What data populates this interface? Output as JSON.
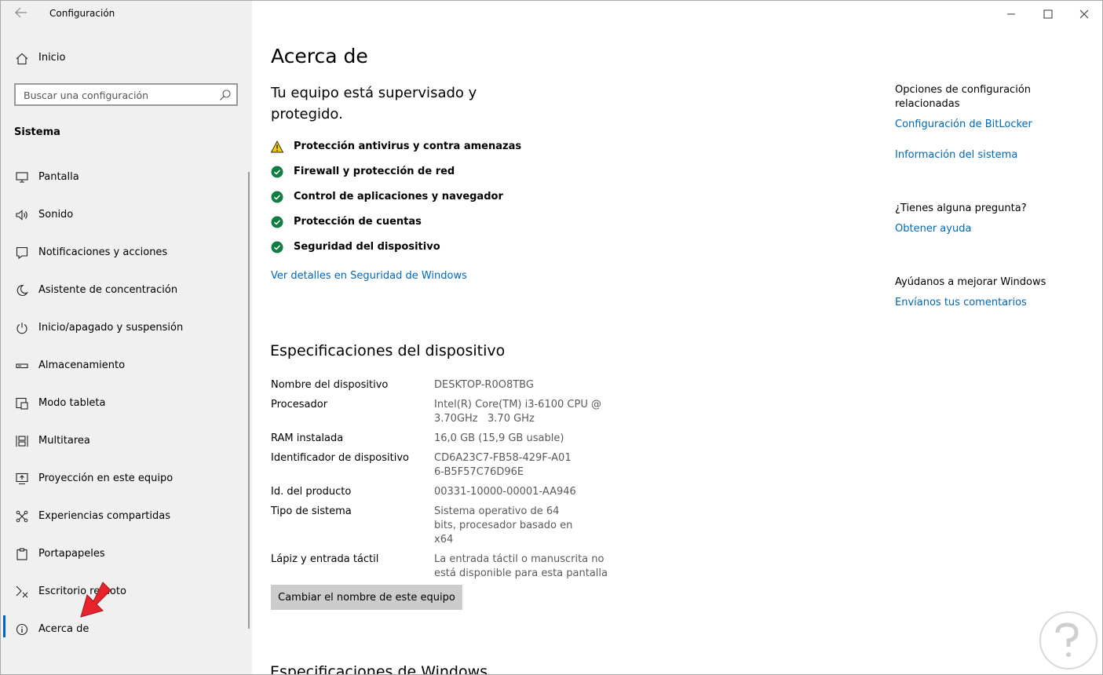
{
  "window": {
    "title": "Configuración",
    "controls": {
      "minimize": "minimize-icon",
      "maximize": "maximize-icon",
      "close": "close-icon"
    }
  },
  "sidebar": {
    "home_label": "Inicio",
    "search_placeholder": "Buscar una configuración",
    "section_title": "Sistema",
    "items": [
      {
        "label": "Pantalla",
        "icon": "display-icon"
      },
      {
        "label": "Sonido",
        "icon": "speaker-icon"
      },
      {
        "label": "Notificaciones y acciones",
        "icon": "notification-icon"
      },
      {
        "label": "Asistente de concentración",
        "icon": "moon-icon"
      },
      {
        "label": "Inicio/apagado y suspensión",
        "icon": "power-icon"
      },
      {
        "label": "Almacenamiento",
        "icon": "storage-icon"
      },
      {
        "label": "Modo tableta",
        "icon": "tablet-icon"
      },
      {
        "label": "Multitarea",
        "icon": "multitask-icon"
      },
      {
        "label": "Proyección en este equipo",
        "icon": "projection-icon"
      },
      {
        "label": "Experiencias compartidas",
        "icon": "shared-icon"
      },
      {
        "label": "Portapapeles",
        "icon": "clipboard-icon"
      },
      {
        "label": "Escritorio remoto",
        "icon": "remote-desktop-icon"
      },
      {
        "label": "Acerca de",
        "icon": "info-icon",
        "active": true
      }
    ]
  },
  "main": {
    "title": "Acerca de",
    "protection_heading": "Tu equipo está supervisado y protegido.",
    "status_items": [
      {
        "label": "Protección antivirus y contra amenazas",
        "status": "warning"
      },
      {
        "label": "Firewall y protección de red",
        "status": "ok"
      },
      {
        "label": "Control de aplicaciones y navegador",
        "status": "ok"
      },
      {
        "label": "Protección de cuentas",
        "status": "ok"
      },
      {
        "label": "Seguridad del dispositivo",
        "status": "ok"
      }
    ],
    "security_link": "Ver detalles en Seguridad de Windows",
    "specs_title": "Especificaciones del dispositivo",
    "specs": [
      {
        "key": "Nombre del dispositivo",
        "value": "DESKTOP-R0O8TBG"
      },
      {
        "key": "Procesador",
        "value": "Intel(R) Core(TM) i3-6100 CPU @ 3.70GHz   3.70 GHz"
      },
      {
        "key": "RAM instalada",
        "value": "16,0 GB (15,9 GB usable)"
      },
      {
        "key": "Identificador de dispositivo",
        "value": "CD6A23C7-FB58-429F-A016-B5F57C76D96E"
      },
      {
        "key": "Id. del producto",
        "value": "00331-10000-00001-AA946"
      },
      {
        "key": "Tipo de sistema",
        "value": "Sistema operativo de 64 bits, procesador basado en x64"
      },
      {
        "key": "Lápiz y entrada táctil",
        "value": "La entrada táctil o manuscrita no está disponible para esta pantalla"
      }
    ],
    "rename_button": "Cambiar el nombre de este equipo",
    "windows_specs_title": "Especificaciones de Windows"
  },
  "related": {
    "heading": "Opciones de configuración relacionadas",
    "bitlocker_link": "Configuración de BitLocker",
    "sysinfo_link": "Información del sistema",
    "question_heading": "¿Tienes alguna pregunta?",
    "help_link": "Obtener ayuda",
    "improve_heading": "Ayúdanos a mejorar Windows",
    "feedback_link": "Envíanos tus comentarios"
  },
  "colors": {
    "accent": "#0067b8",
    "sidebar_bg": "#f0f0f0",
    "ok_green": "#107c41",
    "warning_yellow": "#f2c811",
    "annotation_arrow": "#e8232b"
  }
}
